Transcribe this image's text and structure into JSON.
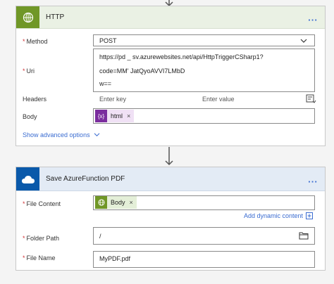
{
  "http_card": {
    "title": "HTTP",
    "more_label": "...",
    "method_label": "Method",
    "method_value": "POST",
    "uri_label": "Uri",
    "uri_lines": [
      "https://pd _        sv.azurewebsites.net/api/HttpTriggerCSharp1?",
      "code=MM'                                      JatQyoAVVI7LMbD",
      "w=="
    ],
    "headers_label": "Headers",
    "header_key_placeholder": "Enter key",
    "header_value_placeholder": "Enter value",
    "body_label": "Body",
    "body_token": "html",
    "body_token_icon": "{x}",
    "remove_token": "×",
    "show_advanced": "Show advanced options"
  },
  "save_card": {
    "title": "Save AzureFunction PDF",
    "more_label": "...",
    "file_content_label": "File Content",
    "file_content_token": "Body",
    "remove_token": "×",
    "add_dynamic_content": "Add dynamic content",
    "folder_path_label": "Folder Path",
    "folder_path_value": "/",
    "file_name_label": "File Name",
    "file_name_value": "MyPDF.pdf"
  },
  "required_marker": "*",
  "icons": {
    "http": "globe-icon",
    "onedrive": "cloud-icon",
    "dropdown": "chevron-down-icon",
    "expression": "expression-icon",
    "folder": "folder-icon",
    "switch_mode": "text-mode-icon",
    "add": "plus-icon"
  },
  "colors": {
    "http_brand": "#709727",
    "onedrive_brand": "#0a59aa",
    "expression_token": "#7b2d9e",
    "link": "#3a6cd1",
    "required": "#d13438"
  }
}
